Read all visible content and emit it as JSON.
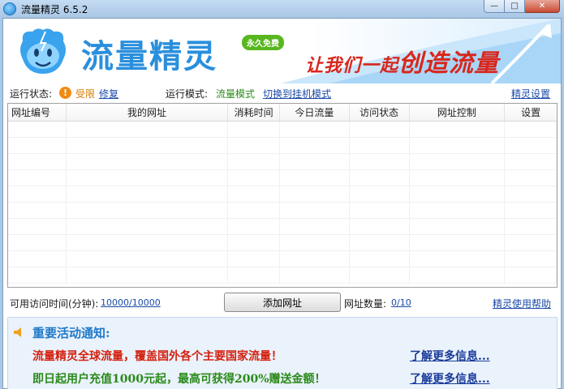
{
  "window": {
    "title": "流量精灵 6.5.2",
    "min_label": "—",
    "max_label": "□",
    "close_label": "✕"
  },
  "banner": {
    "logo_text": "流量精灵",
    "badge": "永久免费",
    "slogan_prefix": "让我们一起",
    "slogan_main": "创造流量"
  },
  "status": {
    "state_label": "运行状态:",
    "state_value": "受限",
    "repair_link": "修复",
    "mode_label": "运行模式:",
    "mode_value": "流量模式",
    "switch_link": "切换到挂机模式",
    "settings_link": "精灵设置"
  },
  "table": {
    "columns": [
      "网址编号",
      "我的网址",
      "消耗时间",
      "今日流量",
      "访问状态",
      "网址控制",
      "设置"
    ],
    "rows": []
  },
  "controls": {
    "avail_label": "可用访问时间(分钟):",
    "avail_value": "10000/10000",
    "add_button": "添加网址",
    "count_label": "网址数量:",
    "count_value": "0/10",
    "help_link": "精灵使用帮助"
  },
  "notice": {
    "title": "重要活动通知:",
    "line1": "流量精灵全球流量，覆盖国外各个主要国家流量！",
    "line1_link": "了解更多信息...",
    "line2": "即日起用户充值1000元起，最高可获得200%赠送金额！",
    "line2_link": "了解更多信息..."
  },
  "colors": {
    "brand_blue": "#2a8fdc",
    "slogan_red": "#d9261c",
    "link_blue": "#1a4aa8",
    "notice_red": "#d4200f",
    "notice_green": "#2a8a1a"
  }
}
